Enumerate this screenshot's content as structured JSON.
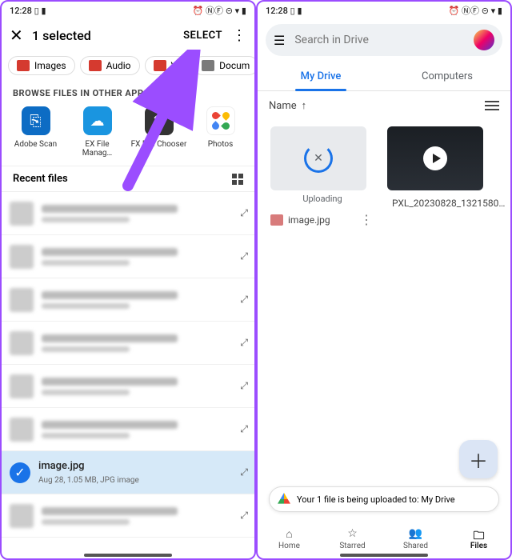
{
  "status": {
    "time": "12:28",
    "icons": "▯ ▮",
    "right": "⏰ ⓃⒻ ⊝ ▾ ▮"
  },
  "left": {
    "header": {
      "title": "1 selected",
      "select": "SELECT"
    },
    "chips": [
      {
        "label": "Images",
        "cls": "ic-red"
      },
      {
        "label": "Audio",
        "cls": "ic-red"
      },
      {
        "label": "Vi",
        "cls": "ic-red"
      },
      {
        "label": "Docum",
        "cls": "ic-gray"
      }
    ],
    "browse_label": "BROWSE FILES IN OTHER APPS",
    "apps": [
      {
        "name": "Adobe Scan",
        "cls": "b-adobe",
        "glyph": "⎘"
      },
      {
        "name": "EX File Manag…",
        "cls": "b-ex",
        "glyph": "☁"
      },
      {
        "name": "FX File Chooser",
        "cls": "b-fx",
        "glyph": "✖"
      },
      {
        "name": "Photos",
        "cls": "b-ph",
        "glyph": ""
      }
    ],
    "recent_label": "Recent files",
    "selected_file": {
      "name": "image.jpg",
      "meta": "Aug 28, 1.05 MB, JPG image"
    }
  },
  "right": {
    "search_placeholder": "Search in Drive",
    "tabs": {
      "mydrive": "My Drive",
      "computers": "Computers"
    },
    "sort": {
      "by": "Name",
      "dir": "↑"
    },
    "item_upload": {
      "caption": "Uploading",
      "name": "image.jpg"
    },
    "item_video": {
      "name": "PXL_20230828_1321580…"
    },
    "toast": "Your 1 file is being uploaded to: My Drive",
    "nav": {
      "home": "Home",
      "starred": "Starred",
      "shared": "Shared",
      "files": "Files"
    }
  }
}
